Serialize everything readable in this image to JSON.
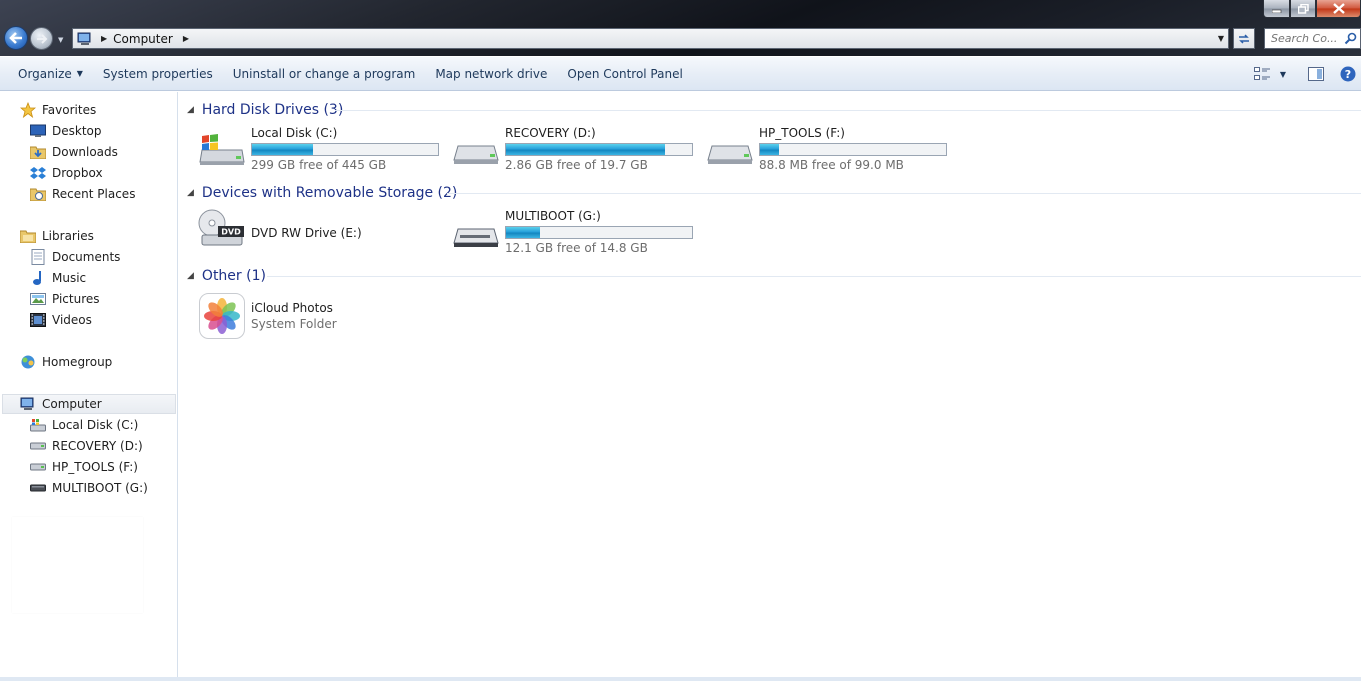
{
  "window": {
    "controls": {
      "minimize": "minimize",
      "maximize": "maximize",
      "close": "close"
    }
  },
  "address": {
    "breadcrumb": "Computer"
  },
  "search": {
    "placeholder": "Search Co..."
  },
  "toolbar": {
    "organize": "Organize",
    "system_properties": "System properties",
    "uninstall": "Uninstall or change a program",
    "map_network": "Map network drive",
    "open_control_panel": "Open Control Panel"
  },
  "sidebar": {
    "favorites": {
      "label": "Favorites",
      "items": [
        "Desktop",
        "Downloads",
        "Dropbox",
        "Recent Places"
      ]
    },
    "libraries": {
      "label": "Libraries",
      "items": [
        "Documents",
        "Music",
        "Pictures",
        "Videos"
      ]
    },
    "homegroup": "Homegroup",
    "computer": {
      "label": "Computer",
      "items": [
        "Local Disk (C:)",
        "RECOVERY (D:)",
        "HP_TOOLS (F:)",
        "MULTIBOOT (G:)"
      ]
    }
  },
  "groups": {
    "hard_disks": {
      "title": "Hard Disk Drives (3)",
      "drives": [
        {
          "name": "Local Disk (C:)",
          "info": "299 GB free of 445 GB",
          "used_fraction": 0.328
        },
        {
          "name": "RECOVERY (D:)",
          "info": "2.86 GB free of 19.7 GB",
          "used_fraction": 0.855
        },
        {
          "name": "HP_TOOLS (F:)",
          "info": "88.8 MB free of 99.0 MB",
          "used_fraction": 0.103
        }
      ]
    },
    "removable": {
      "title": "Devices with Removable Storage (2)",
      "dvd": {
        "name": "DVD RW Drive (E:)",
        "icon_text": "DVD"
      },
      "usb": {
        "name": "MULTIBOOT (G:)",
        "info": "12.1 GB free of 14.8 GB",
        "used_fraction": 0.182
      }
    },
    "other": {
      "title": "Other (1)",
      "item": {
        "name": "iCloud Photos",
        "subtitle": "System Folder"
      }
    }
  },
  "colors": {
    "accent": "#1e3287",
    "bar_fill": "#26a0da",
    "toolbar_text": "#1e395b"
  }
}
